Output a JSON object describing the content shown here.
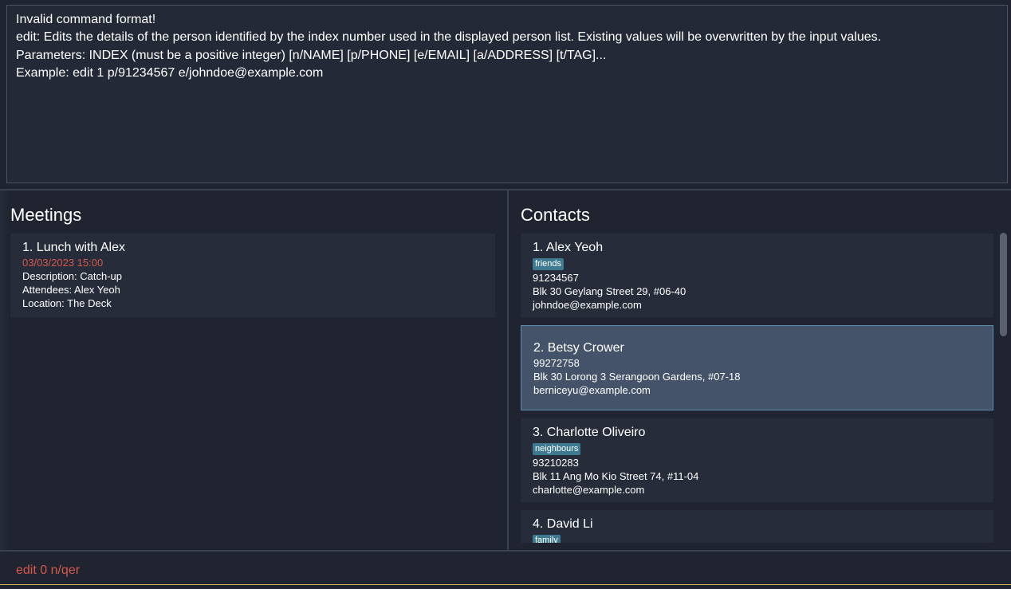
{
  "result": {
    "lines": [
      "Invalid command format!",
      "edit: Edits the details of the person identified by the index number used in the displayed person list. Existing values will be overwritten by the input values.",
      "Parameters: INDEX (must be a positive integer) [n/NAME] [p/PHONE] [e/EMAIL] [a/ADDRESS] [t/TAG]...",
      "Example: edit 1 p/91234567 e/johndoe@example.com"
    ]
  },
  "meetings": {
    "title": "Meetings",
    "items": [
      {
        "heading": "1.  Lunch with Alex",
        "datetime": "03/03/2023 15:00",
        "description": "Description: Catch-up",
        "attendees": "Attendees: Alex Yeoh",
        "location": "Location: The Deck"
      }
    ]
  },
  "contacts": {
    "title": "Contacts",
    "items": [
      {
        "heading": "1.  Alex Yeoh",
        "tag": "friends",
        "phone": "91234567",
        "address": "Blk 30 Geylang Street 29, #06-40",
        "email": "johndoe@example.com"
      },
      {
        "heading": "2.  Betsy Crower",
        "tag": "",
        "phone": "99272758",
        "address": "Blk 30 Lorong 3 Serangoon Gardens, #07-18",
        "email": "berniceyu@example.com"
      },
      {
        "heading": "3.  Charlotte Oliveiro",
        "tag": "neighbours",
        "phone": "93210283",
        "address": "Blk 11 Ang Mo Kio Street 74, #11-04",
        "email": "charlotte@example.com"
      },
      {
        "heading": "4.  David Li",
        "tag": "family"
      }
    ]
  },
  "command": {
    "value": "edit 0 n/qer"
  },
  "colors": {
    "accent_error": "#d6574b",
    "tag_bg": "#3e7b91",
    "selected_bg": "#45536a"
  }
}
